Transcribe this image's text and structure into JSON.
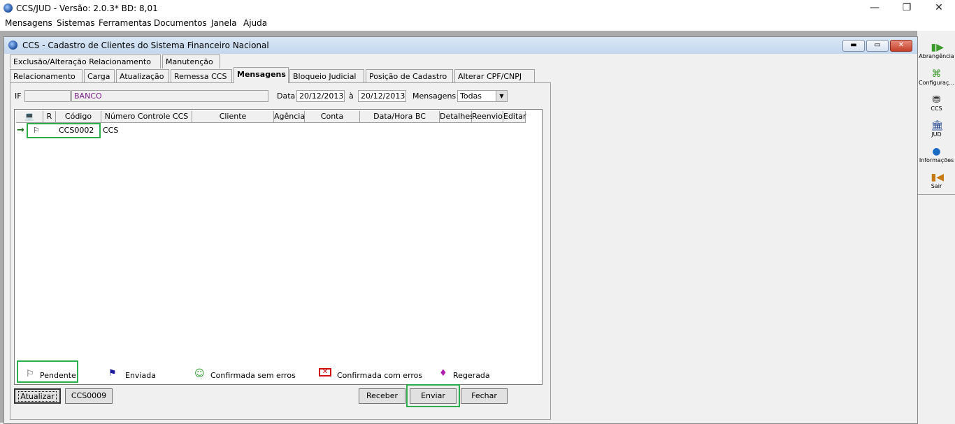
{
  "window": {
    "title": "CCS/JUD - Versão: 2.0.3* BD: 8,01",
    "minimize": "—",
    "restore": "❐",
    "close": "✕"
  },
  "menubar": [
    {
      "label": "Mensagens"
    },
    {
      "label": "Sistemas"
    },
    {
      "label": "Ferramentas"
    },
    {
      "label": "Documentos"
    },
    {
      "label": "Janela"
    },
    {
      "label": "Ajuda"
    }
  ],
  "right_toolbar": [
    {
      "label": "Abrangência",
      "icon": "abrangencia-icon",
      "color": "#3a9a2a"
    },
    {
      "label": "Configuraç...",
      "icon": "configuracao-icon",
      "color": "#3a9a2a"
    },
    {
      "label": "CCS",
      "icon": "ccs-icon",
      "color": "#333333"
    },
    {
      "label": "JUD",
      "icon": "jud-icon",
      "color": "#1a3f8a"
    },
    {
      "label": "Informações",
      "icon": "informacoes-icon",
      "color": "#1a6bc4"
    },
    {
      "label": "Sair",
      "icon": "sair-icon",
      "color": "#c47a10"
    }
  ],
  "child_window": {
    "title": "CCS - Cadastro de Clientes do Sistema Financeiro Nacional"
  },
  "tabs_row1": [
    {
      "label": "Exclusão/Alteração Relacionamento"
    },
    {
      "label": "Manutenção"
    }
  ],
  "tabs_row2": [
    {
      "label": "Relacionamento"
    },
    {
      "label": "Carga"
    },
    {
      "label": "Atualização"
    },
    {
      "label": "Remessa CCS"
    },
    {
      "label": "Mensagens",
      "active": true
    },
    {
      "label": "Bloqueio Judicial"
    },
    {
      "label": "Posição de Cadastro"
    },
    {
      "label": "Alterar CPF/CNPJ"
    }
  ],
  "filters": {
    "if_label": "IF",
    "if_code": "",
    "if_name": "BANCO",
    "data_label": "Data",
    "date_from": "20/12/2013",
    "to_label": "à",
    "date_to": "20/12/2013",
    "mensagens_label": "Mensagens",
    "mensagens_value": "Todas"
  },
  "grid": {
    "columns": [
      "",
      "R",
      "Código",
      "Número Controle CCS",
      "Cliente",
      "Agência",
      "Conta",
      "Data/Hora BC",
      "Detalhes",
      "Reenvio",
      "Editar"
    ],
    "rows": [
      {
        "codigo": "CCS0002",
        "numero": "CCS",
        "cliente": "",
        "agencia": "",
        "conta": "",
        "data_hora": ""
      }
    ]
  },
  "legend": [
    {
      "label": "Pendente",
      "icon": "flag-outline-icon",
      "color": "#444444"
    },
    {
      "label": "Enviada",
      "icon": "flag-blue-icon",
      "color": "#1a1a9a"
    },
    {
      "label": "Confirmada sem erros",
      "icon": "smiley-icon",
      "color": "#2a9a2a"
    },
    {
      "label": "Confirmada com erros",
      "icon": "error-envelope-icon",
      "color": "#d01010"
    },
    {
      "label": "Regerada",
      "icon": "regerada-icon",
      "color": "#b020b0"
    }
  ],
  "buttons": {
    "atualizar": "Atualizar",
    "ccs0009": "CCS0009",
    "receber": "Receber",
    "enviar": "Enviar",
    "fechar": "Fechar"
  },
  "colors": {
    "highlight": "#2cae4a",
    "if_name": "#7a1f8a"
  }
}
